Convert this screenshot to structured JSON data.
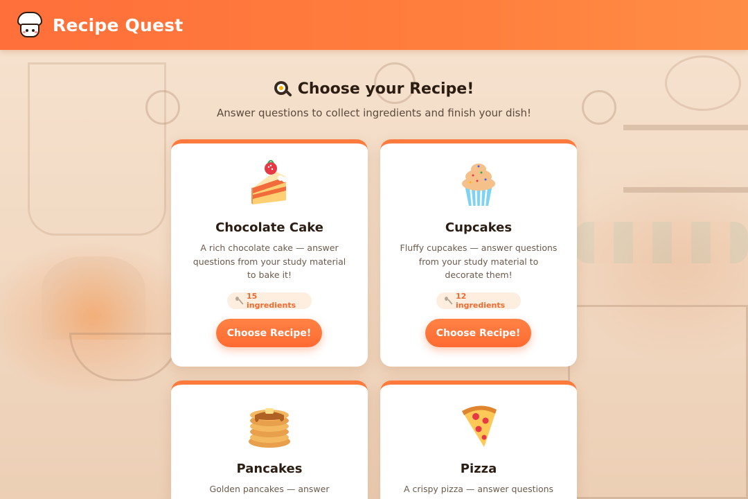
{
  "app": {
    "title": "Recipe Quest"
  },
  "page": {
    "title": "Choose your Recipe!",
    "subtitle": "Answer questions to collect ingredients and finish your dish!"
  },
  "recipes": [
    {
      "name": "Chocolate Cake",
      "icon": "cake-slice-icon",
      "description": "A rich chocolate cake — answer questions from your study material to bake it!",
      "ingredients": "15 ingredients",
      "button": "Choose Recipe!"
    },
    {
      "name": "Cupcakes",
      "icon": "cupcake-icon",
      "description": "Fluffy cupcakes — answer questions from your study material to decorate them!",
      "ingredients": "12 ingredients",
      "button": "Choose Recipe!"
    },
    {
      "name": "Pancakes",
      "icon": "pancakes-icon",
      "description": "Golden pancakes — answer questions",
      "ingredients": "",
      "button": ""
    },
    {
      "name": "Pizza",
      "icon": "pizza-slice-icon",
      "description": "A crispy pizza — answer questions from",
      "ingredients": "",
      "button": ""
    }
  ],
  "colors": {
    "accent": "#ff7a3c",
    "header": "#ff7840",
    "badge_bg": "#fdeee0",
    "badge_text": "#ef6a2f"
  }
}
